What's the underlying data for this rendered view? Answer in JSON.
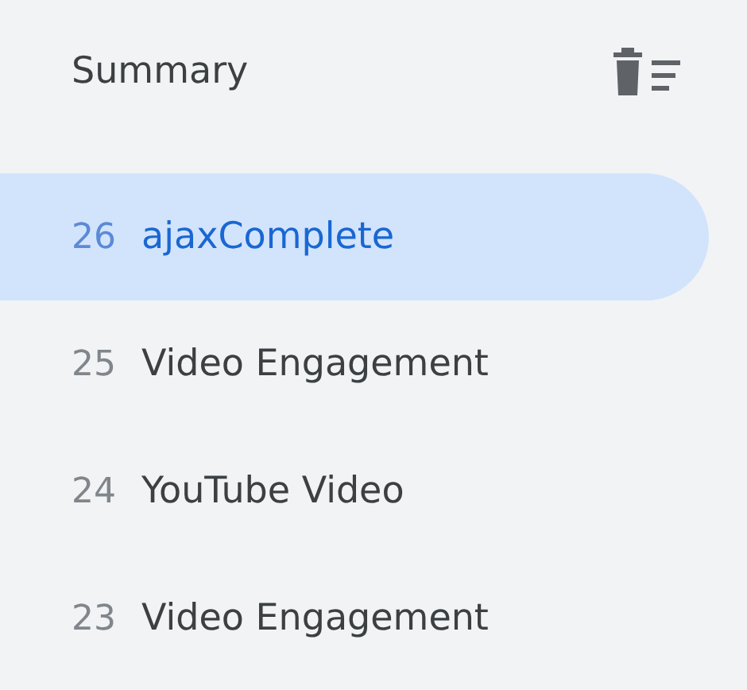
{
  "header": {
    "title": "Summary"
  },
  "events": [
    {
      "number": "26",
      "name": "ajaxComplete",
      "selected": true
    },
    {
      "number": "25",
      "name": "Video Engagement",
      "selected": false
    },
    {
      "number": "24",
      "name": "YouTube Video",
      "selected": false
    },
    {
      "number": "23",
      "name": "Video Engagement",
      "selected": false
    }
  ]
}
